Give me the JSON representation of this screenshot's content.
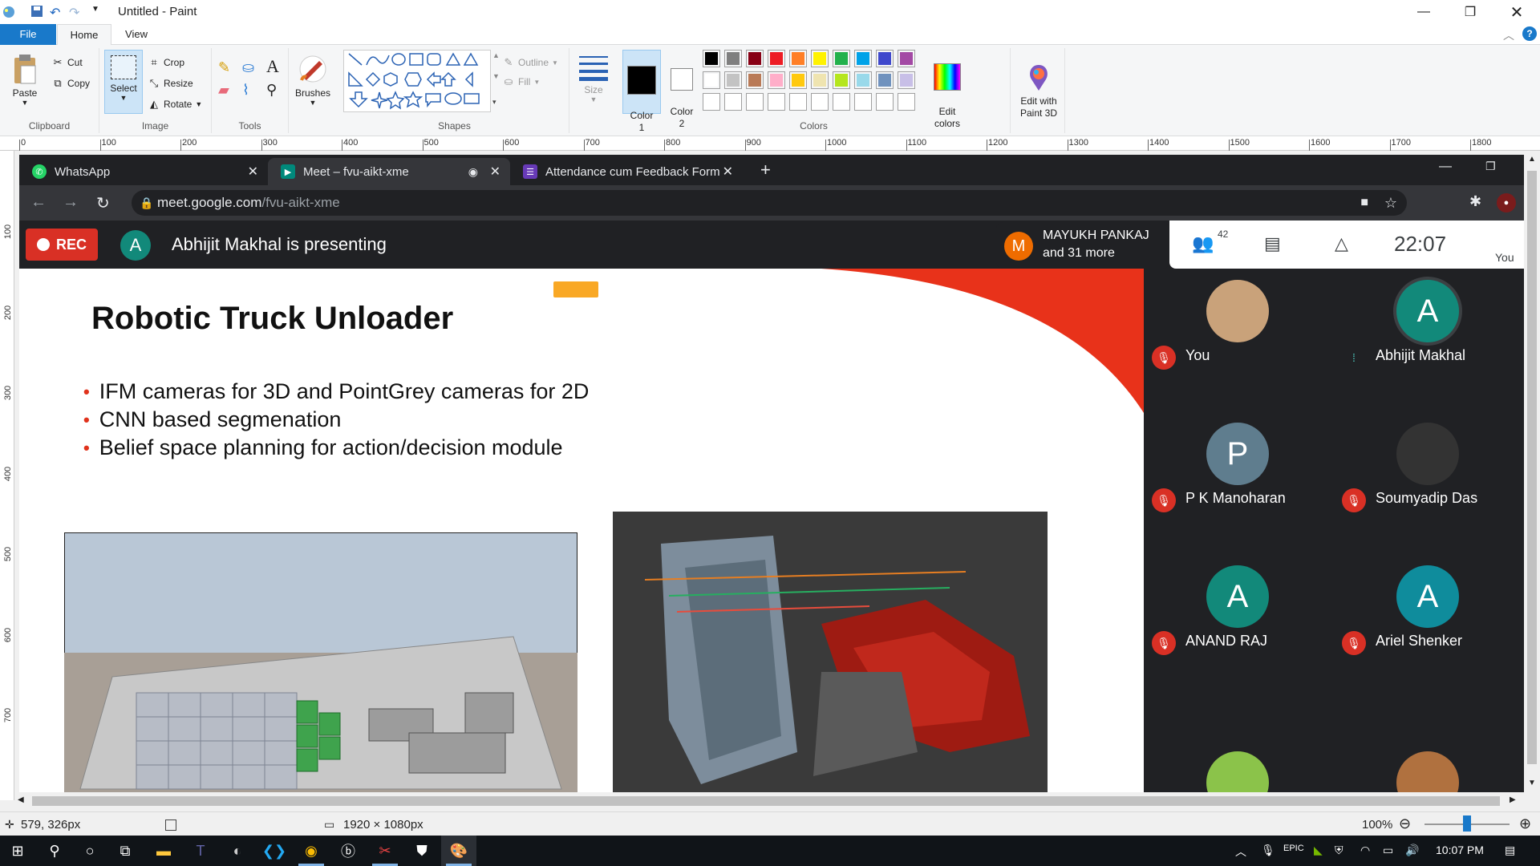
{
  "window": {
    "title": "Untitled - Paint"
  },
  "ribbon": {
    "tabs": [
      "File",
      "Home",
      "View"
    ],
    "clipboard": {
      "paste": "Paste",
      "cut": "Cut",
      "copy": "Copy",
      "group": "Clipboard"
    },
    "image": {
      "select": "Select",
      "crop": "Crop",
      "resize": "Resize",
      "rotate": "Rotate",
      "group": "Image"
    },
    "tools": {
      "group": "Tools"
    },
    "brushes": "Brushes",
    "shapes": {
      "outline": "Outline",
      "fill": "Fill",
      "group": "Shapes"
    },
    "size": "Size",
    "color1": "Color\n1",
    "color2": "Color\n2",
    "colors_group": "Colors",
    "edit_colors": "Edit\ncolors",
    "edit_paint3d": "Edit with\nPaint 3D",
    "palette": [
      "#000000",
      "#7f7f7f",
      "#880015",
      "#ed1c24",
      "#ff7f27",
      "#fff200",
      "#22b14c",
      "#00a2e8",
      "#3f48cc",
      "#a349a4",
      "#ffffff",
      "#c3c3c3",
      "#b97a57",
      "#ffaec9",
      "#ffc90e",
      "#efe4b0",
      "#b5e61d",
      "#99d9ea",
      "#7092be",
      "#c8bfe7"
    ]
  },
  "ruler": {
    "top": [
      "0",
      "100",
      "200",
      "300",
      "400",
      "500",
      "600",
      "700",
      "800",
      "900",
      "1000",
      "1100",
      "1200",
      "1300",
      "1400",
      "1500",
      "1600",
      "1700",
      "1800"
    ],
    "left": [
      "100",
      "200",
      "300",
      "400",
      "500",
      "600",
      "700"
    ]
  },
  "chrome": {
    "tabs": [
      {
        "label": "WhatsApp"
      },
      {
        "label": "Meet – fvu-aikt-xme"
      },
      {
        "label": "Attendance cum Feedback Form"
      }
    ],
    "url_host": "meet.google.com",
    "url_path": "/fvu-aikt-xme"
  },
  "meet": {
    "rec": "REC",
    "presenter_initial": "A",
    "presenting": "Abhijit Makhal is presenting",
    "others_initial": "M",
    "others_line1": "MAYUKH PANKAJ",
    "others_line2": "and 31 more",
    "participants_count": "42",
    "time": "22:07",
    "you_label": "You",
    "participants": [
      {
        "name": "You",
        "initial": "",
        "color": "#c9a27a"
      },
      {
        "name": "Abhijit Makhal",
        "initial": "A",
        "color": "#12897a"
      },
      {
        "name": "P K Manoharan",
        "initial": "P",
        "color": "#5f7d8e"
      },
      {
        "name": "Soumyadip Das",
        "initial": "",
        "color": "#333333"
      },
      {
        "name": "ANAND RAJ",
        "initial": "A",
        "color": "#12897a"
      },
      {
        "name": "Ariel Shenker",
        "initial": "A",
        "color": "#0f8c9c"
      }
    ]
  },
  "slide": {
    "title": "Robotic Truck Unloader",
    "bullets": [
      "IFM cameras for 3D and PointGrey cameras for 2D",
      "CNN based segmenation",
      "Belief space planning for action/decision module"
    ]
  },
  "status": {
    "cursor_pos": "579, 326px",
    "canvas_size": "1920 × 1080px",
    "zoom": "100%"
  },
  "taskbar": {
    "time": "10:07 PM"
  }
}
